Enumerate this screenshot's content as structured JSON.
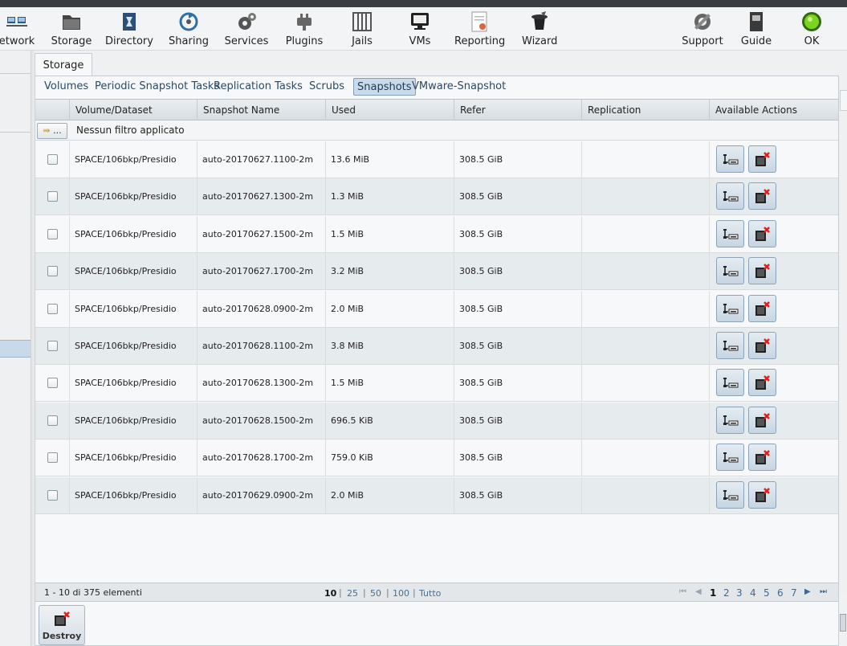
{
  "toolbar": {
    "items": [
      {
        "label": "etwork",
        "icon": "network-icon"
      },
      {
        "label": "Storage",
        "icon": "storage-icon"
      },
      {
        "label": "Directory",
        "icon": "directory-icon"
      },
      {
        "label": "Sharing",
        "icon": "sharing-icon"
      },
      {
        "label": "Services",
        "icon": "services-icon"
      },
      {
        "label": "Plugins",
        "icon": "plugins-icon"
      },
      {
        "label": "Jails",
        "icon": "jails-icon"
      },
      {
        "label": "VMs",
        "icon": "vms-icon"
      },
      {
        "label": "Reporting",
        "icon": "reporting-icon"
      },
      {
        "label": "Wizard",
        "icon": "wizard-icon"
      },
      {
        "label": "Support",
        "icon": "support-icon"
      },
      {
        "label": "Guide",
        "icon": "guide-icon"
      },
      {
        "label": "OK",
        "icon": "status-ok-icon"
      }
    ]
  },
  "main_tab": "Storage",
  "subtabs": [
    "Volumes",
    "Periodic Snapshot Tasks",
    "Replication Tasks",
    "Scrubs",
    "Snapshots",
    "VMware-Snapshot"
  ],
  "active_subtab": "Snapshots",
  "grid": {
    "columns": [
      "Volume/Dataset",
      "Snapshot Name",
      "Used",
      "Refer",
      "Replication",
      "Available Actions"
    ],
    "filter_button": "...",
    "filter_text": "Nessun filtro applicato",
    "rows": [
      {
        "volume": "SPACE/106bkp/Presidio",
        "snapshot": "auto-20170627.1100-2m",
        "used": "13.6 MiB",
        "refer": "308.5 GiB",
        "replication": ""
      },
      {
        "volume": "SPACE/106bkp/Presidio",
        "snapshot": "auto-20170627.1300-2m",
        "used": "1.3 MiB",
        "refer": "308.5 GiB",
        "replication": ""
      },
      {
        "volume": "SPACE/106bkp/Presidio",
        "snapshot": "auto-20170627.1500-2m",
        "used": "1.5 MiB",
        "refer": "308.5 GiB",
        "replication": ""
      },
      {
        "volume": "SPACE/106bkp/Presidio",
        "snapshot": "auto-20170627.1700-2m",
        "used": "3.2 MiB",
        "refer": "308.5 GiB",
        "replication": ""
      },
      {
        "volume": "SPACE/106bkp/Presidio",
        "snapshot": "auto-20170628.0900-2m",
        "used": "2.0 MiB",
        "refer": "308.5 GiB",
        "replication": ""
      },
      {
        "volume": "SPACE/106bkp/Presidio",
        "snapshot": "auto-20170628.1100-2m",
        "used": "3.8 MiB",
        "refer": "308.5 GiB",
        "replication": ""
      },
      {
        "volume": "SPACE/106bkp/Presidio",
        "snapshot": "auto-20170628.1300-2m",
        "used": "1.5 MiB",
        "refer": "308.5 GiB",
        "replication": ""
      },
      {
        "volume": "SPACE/106bkp/Presidio",
        "snapshot": "auto-20170628.1500-2m",
        "used": "696.5 KiB",
        "refer": "308.5 GiB",
        "replication": ""
      },
      {
        "volume": "SPACE/106bkp/Presidio",
        "snapshot": "auto-20170628.1700-2m",
        "used": "759.0 KiB",
        "refer": "308.5 GiB",
        "replication": ""
      },
      {
        "volume": "SPACE/106bkp/Presidio",
        "snapshot": "auto-20170629.0900-2m",
        "used": "2.0 MiB",
        "refer": "308.5 GiB",
        "replication": ""
      }
    ]
  },
  "pagination": {
    "count_text": "1 - 10 di 375 elementi",
    "sizes": [
      "10",
      "25",
      "50",
      "100",
      "Tutto"
    ],
    "selected_size": "10",
    "pages": [
      "1",
      "2",
      "3",
      "4",
      "5",
      "6",
      "7"
    ],
    "current_page": "1",
    "first": "⏮",
    "prev": "◀",
    "next": "▶",
    "last": "⏭"
  },
  "destroy_label": "Destroy"
}
